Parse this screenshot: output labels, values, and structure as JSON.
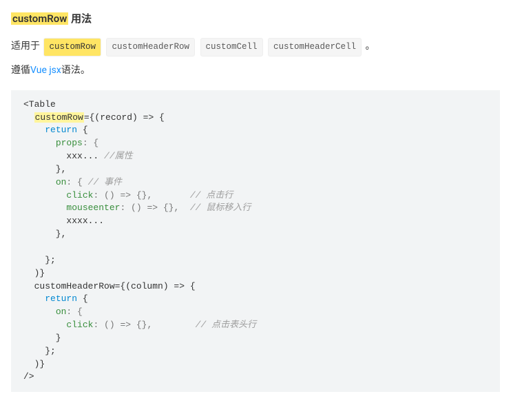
{
  "heading": {
    "hl": "customRow",
    "rest": " 用法"
  },
  "para1": {
    "pre": "适用于 ",
    "tags": [
      "customRow",
      "customHeaderRow",
      "customCell",
      "customHeaderCell"
    ],
    "post": " 。"
  },
  "para2": {
    "pre": "遵循",
    "link": "Vue jsx",
    "post": "语法。"
  },
  "code": {
    "l1a": "<Table",
    "l2a": "  ",
    "l2hl": "customRow",
    "l2b": "={(record) => {",
    "l3a": "    ",
    "l3kw": "return",
    "l3b": " {",
    "l4a": "      ",
    "l4attr": "props",
    "l4b": ": {",
    "l5a": "        xxx... ",
    "l5c": "//属性",
    "l6": "      },",
    "l7a": "      ",
    "l7attr": "on",
    "l7b": ": { ",
    "l7c": "// 事件",
    "l8a": "        ",
    "l8attr": "click",
    "l8b": ": () => {},       ",
    "l8c": "// 点击行",
    "l9a": "        ",
    "l9attr": "mouseenter",
    "l9b": ": () => {},  ",
    "l9c": "// 鼠标移入行",
    "l10": "        xxxx...",
    "l11": "      },",
    "l12": "",
    "l13": "    };",
    "l14": "  )}",
    "l15": "  customHeaderRow={(column) => {",
    "l16a": "    ",
    "l16kw": "return",
    "l16b": " {",
    "l17a": "      ",
    "l17attr": "on",
    "l17b": ": {",
    "l18a": "        ",
    "l18attr": "click",
    "l18b": ": () => {},        ",
    "l18c": "// 点击表头行",
    "l19": "      }",
    "l20": "    };",
    "l21": "  )}",
    "l22": "/>"
  }
}
